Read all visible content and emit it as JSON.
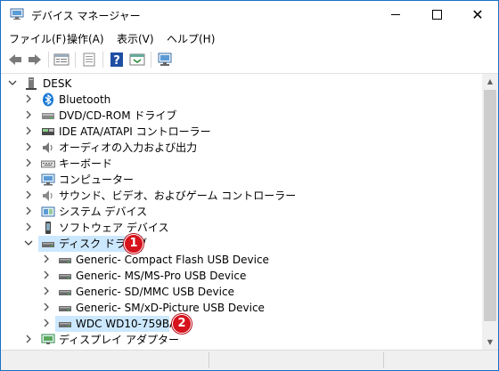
{
  "window": {
    "title": "デバイス マネージャー"
  },
  "menu": [
    {
      "label": "ファイル(F)"
    },
    {
      "label": "操作(A)"
    },
    {
      "label": "表示(V)"
    },
    {
      "label": "ヘルプ(H)"
    }
  ],
  "toolbar": [
    {
      "icon": "back-arrow-icon"
    },
    {
      "icon": "forward-arrow-icon"
    },
    {
      "icon": "properties-icon"
    },
    {
      "icon": "document-icon"
    },
    {
      "icon": "help-icon"
    },
    {
      "icon": "view-icon"
    },
    {
      "icon": "monitor-scan-icon"
    }
  ],
  "tree": {
    "root": {
      "label": "DESK",
      "expanded": true
    },
    "categories": [
      {
        "label": "Bluetooth",
        "icon": "bluetooth-icon",
        "expanded": false
      },
      {
        "label": "DVD/CD-ROM ドライブ",
        "icon": "dvd-icon",
        "expanded": false
      },
      {
        "label": "IDE ATA/ATAPI コントローラー",
        "icon": "ide-controller-icon",
        "expanded": false
      },
      {
        "label": "オーディオの入力および出力",
        "icon": "speaker-icon",
        "expanded": false
      },
      {
        "label": "キーボード",
        "icon": "keyboard-icon",
        "expanded": false
      },
      {
        "label": "コンピューター",
        "icon": "computer-icon",
        "expanded": false
      },
      {
        "label": "サウンド、ビデオ、およびゲーム コントローラー",
        "icon": "sound-icon",
        "expanded": false
      },
      {
        "label": "システム デバイス",
        "icon": "system-device-icon",
        "expanded": false
      },
      {
        "label": "ソフトウェア デバイス",
        "icon": "software-device-icon",
        "expanded": false
      },
      {
        "label": "ディスク ドライブ",
        "icon": "disk-drive-icon",
        "expanded": true,
        "badge": "1"
      },
      {
        "label": "ディスプレイ アダプター",
        "icon": "display-adapter-icon",
        "expanded": false
      }
    ],
    "disk_children": [
      {
        "label": "Generic- Compact Flash USB Device"
      },
      {
        "label": "Generic- MS/MS-Pro USB Device"
      },
      {
        "label": "Generic- SD/MMC USB Device"
      },
      {
        "label": "Generic- SM/xD-Picture USB Device"
      },
      {
        "label": "WDC WD10-759BA1",
        "badge": "2",
        "selected": true
      }
    ]
  },
  "colors": {
    "selection": "#cce8ff",
    "badge": "#d6121c",
    "border": "#1a6fc4"
  }
}
